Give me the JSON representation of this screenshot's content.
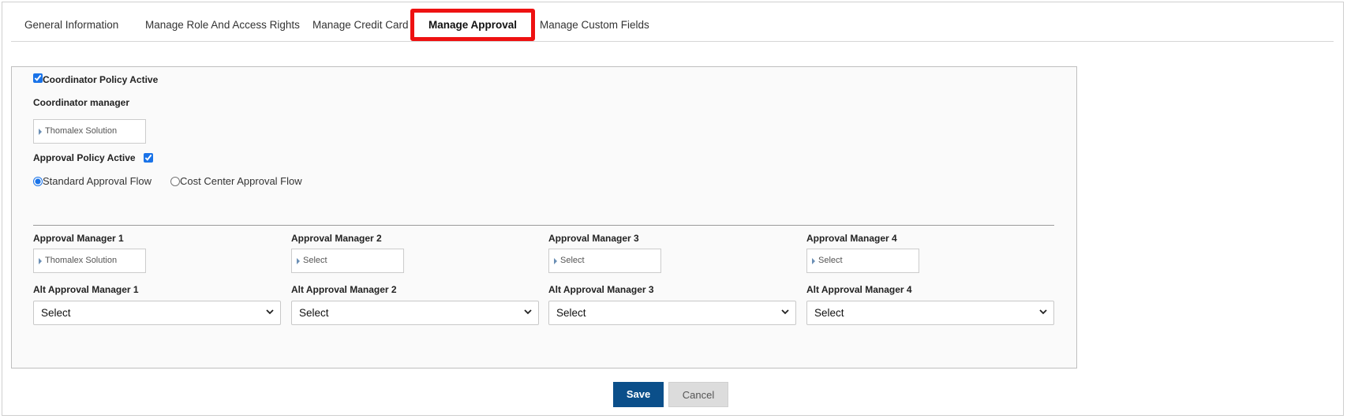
{
  "tabs": [
    {
      "label": "General Information"
    },
    {
      "label": "Manage Role And Access Rights"
    },
    {
      "label": "Manage Credit Card"
    },
    {
      "label": "Manage Approval",
      "active": true
    },
    {
      "label": "Manage Custom Fields"
    }
  ],
  "coordinator": {
    "policy_label": "Coordinator Policy Active",
    "policy_checked": true,
    "manager_label": "Coordinator manager",
    "manager_value": "Thomalex Solution"
  },
  "approval": {
    "policy_label": "Approval Policy Active",
    "policy_checked": true,
    "flow_options": [
      {
        "label": "Standard Approval Flow",
        "selected": true
      },
      {
        "label": "Cost Center Approval Flow",
        "selected": false
      }
    ]
  },
  "managers": [
    {
      "label": "Approval Manager 1",
      "value": "Thomalex Solution"
    },
    {
      "label": "Approval Manager 2",
      "value": "Select"
    },
    {
      "label": "Approval Manager 3",
      "value": "Select"
    },
    {
      "label": "Approval Manager 4",
      "value": "Select"
    }
  ],
  "alt_managers": [
    {
      "label": "Alt Approval Manager 1",
      "value": "Select"
    },
    {
      "label": "Alt Approval Manager 2",
      "value": "Select"
    },
    {
      "label": "Alt Approval Manager 3",
      "value": "Select"
    },
    {
      "label": "Alt Approval Manager 4",
      "value": "Select"
    }
  ],
  "actions": {
    "save_label": "Save",
    "cancel_label": "Cancel"
  },
  "colors": {
    "active_tab_border": "#ee1111",
    "save_bg": "#0b4f8a",
    "cancel_bg": "#dcdcdc",
    "checkbox_accent": "#1a73e8"
  }
}
